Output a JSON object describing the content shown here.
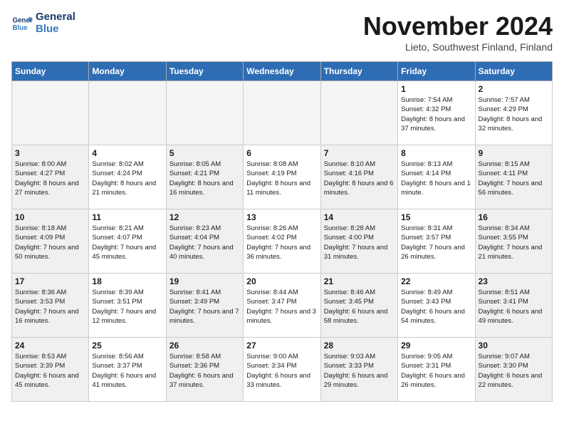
{
  "header": {
    "logo_line1": "General",
    "logo_line2": "Blue",
    "month_title": "November 2024",
    "location": "Lieto, Southwest Finland, Finland"
  },
  "weekdays": [
    "Sunday",
    "Monday",
    "Tuesday",
    "Wednesday",
    "Thursday",
    "Friday",
    "Saturday"
  ],
  "weeks": [
    [
      {
        "day": "",
        "empty": true
      },
      {
        "day": "",
        "empty": true
      },
      {
        "day": "",
        "empty": true
      },
      {
        "day": "",
        "empty": true
      },
      {
        "day": "",
        "empty": true
      },
      {
        "day": "1",
        "sunrise": "Sunrise: 7:54 AM",
        "sunset": "Sunset: 4:32 PM",
        "daylight": "Daylight: 8 hours and 37 minutes."
      },
      {
        "day": "2",
        "sunrise": "Sunrise: 7:57 AM",
        "sunset": "Sunset: 4:29 PM",
        "daylight": "Daylight: 8 hours and 32 minutes."
      }
    ],
    [
      {
        "day": "3",
        "sunrise": "Sunrise: 8:00 AM",
        "sunset": "Sunset: 4:27 PM",
        "daylight": "Daylight: 8 hours and 27 minutes.",
        "shaded": true
      },
      {
        "day": "4",
        "sunrise": "Sunrise: 8:02 AM",
        "sunset": "Sunset: 4:24 PM",
        "daylight": "Daylight: 8 hours and 21 minutes."
      },
      {
        "day": "5",
        "sunrise": "Sunrise: 8:05 AM",
        "sunset": "Sunset: 4:21 PM",
        "daylight": "Daylight: 8 hours and 16 minutes.",
        "shaded": true
      },
      {
        "day": "6",
        "sunrise": "Sunrise: 8:08 AM",
        "sunset": "Sunset: 4:19 PM",
        "daylight": "Daylight: 8 hours and 11 minutes."
      },
      {
        "day": "7",
        "sunrise": "Sunrise: 8:10 AM",
        "sunset": "Sunset: 4:16 PM",
        "daylight": "Daylight: 8 hours and 6 minutes.",
        "shaded": true
      },
      {
        "day": "8",
        "sunrise": "Sunrise: 8:13 AM",
        "sunset": "Sunset: 4:14 PM",
        "daylight": "Daylight: 8 hours and 1 minute."
      },
      {
        "day": "9",
        "sunrise": "Sunrise: 8:15 AM",
        "sunset": "Sunset: 4:11 PM",
        "daylight": "Daylight: 7 hours and 56 minutes.",
        "shaded": true
      }
    ],
    [
      {
        "day": "10",
        "sunrise": "Sunrise: 8:18 AM",
        "sunset": "Sunset: 4:09 PM",
        "daylight": "Daylight: 7 hours and 50 minutes.",
        "shaded": true
      },
      {
        "day": "11",
        "sunrise": "Sunrise: 8:21 AM",
        "sunset": "Sunset: 4:07 PM",
        "daylight": "Daylight: 7 hours and 45 minutes."
      },
      {
        "day": "12",
        "sunrise": "Sunrise: 8:23 AM",
        "sunset": "Sunset: 4:04 PM",
        "daylight": "Daylight: 7 hours and 40 minutes.",
        "shaded": true
      },
      {
        "day": "13",
        "sunrise": "Sunrise: 8:26 AM",
        "sunset": "Sunset: 4:02 PM",
        "daylight": "Daylight: 7 hours and 36 minutes."
      },
      {
        "day": "14",
        "sunrise": "Sunrise: 8:28 AM",
        "sunset": "Sunset: 4:00 PM",
        "daylight": "Daylight: 7 hours and 31 minutes.",
        "shaded": true
      },
      {
        "day": "15",
        "sunrise": "Sunrise: 8:31 AM",
        "sunset": "Sunset: 3:57 PM",
        "daylight": "Daylight: 7 hours and 26 minutes."
      },
      {
        "day": "16",
        "sunrise": "Sunrise: 8:34 AM",
        "sunset": "Sunset: 3:55 PM",
        "daylight": "Daylight: 7 hours and 21 minutes.",
        "shaded": true
      }
    ],
    [
      {
        "day": "17",
        "sunrise": "Sunrise: 8:36 AM",
        "sunset": "Sunset: 3:53 PM",
        "daylight": "Daylight: 7 hours and 16 minutes.",
        "shaded": true
      },
      {
        "day": "18",
        "sunrise": "Sunrise: 8:39 AM",
        "sunset": "Sunset: 3:51 PM",
        "daylight": "Daylight: 7 hours and 12 minutes."
      },
      {
        "day": "19",
        "sunrise": "Sunrise: 8:41 AM",
        "sunset": "Sunset: 3:49 PM",
        "daylight": "Daylight: 7 hours and 7 minutes.",
        "shaded": true
      },
      {
        "day": "20",
        "sunrise": "Sunrise: 8:44 AM",
        "sunset": "Sunset: 3:47 PM",
        "daylight": "Daylight: 7 hours and 3 minutes."
      },
      {
        "day": "21",
        "sunrise": "Sunrise: 8:46 AM",
        "sunset": "Sunset: 3:45 PM",
        "daylight": "Daylight: 6 hours and 58 minutes.",
        "shaded": true
      },
      {
        "day": "22",
        "sunrise": "Sunrise: 8:49 AM",
        "sunset": "Sunset: 3:43 PM",
        "daylight": "Daylight: 6 hours and 54 minutes."
      },
      {
        "day": "23",
        "sunrise": "Sunrise: 8:51 AM",
        "sunset": "Sunset: 3:41 PM",
        "daylight": "Daylight: 6 hours and 49 minutes.",
        "shaded": true
      }
    ],
    [
      {
        "day": "24",
        "sunrise": "Sunrise: 8:53 AM",
        "sunset": "Sunset: 3:39 PM",
        "daylight": "Daylight: 6 hours and 45 minutes.",
        "shaded": true
      },
      {
        "day": "25",
        "sunrise": "Sunrise: 8:56 AM",
        "sunset": "Sunset: 3:37 PM",
        "daylight": "Daylight: 6 hours and 41 minutes."
      },
      {
        "day": "26",
        "sunrise": "Sunrise: 8:58 AM",
        "sunset": "Sunset: 3:36 PM",
        "daylight": "Daylight: 6 hours and 37 minutes.",
        "shaded": true
      },
      {
        "day": "27",
        "sunrise": "Sunrise: 9:00 AM",
        "sunset": "Sunset: 3:34 PM",
        "daylight": "Daylight: 6 hours and 33 minutes."
      },
      {
        "day": "28",
        "sunrise": "Sunrise: 9:03 AM",
        "sunset": "Sunset: 3:33 PM",
        "daylight": "Daylight: 6 hours and 29 minutes.",
        "shaded": true
      },
      {
        "day": "29",
        "sunrise": "Sunrise: 9:05 AM",
        "sunset": "Sunset: 3:31 PM",
        "daylight": "Daylight: 6 hours and 26 minutes."
      },
      {
        "day": "30",
        "sunrise": "Sunrise: 9:07 AM",
        "sunset": "Sunset: 3:30 PM",
        "daylight": "Daylight: 6 hours and 22 minutes.",
        "shaded": true
      }
    ]
  ]
}
